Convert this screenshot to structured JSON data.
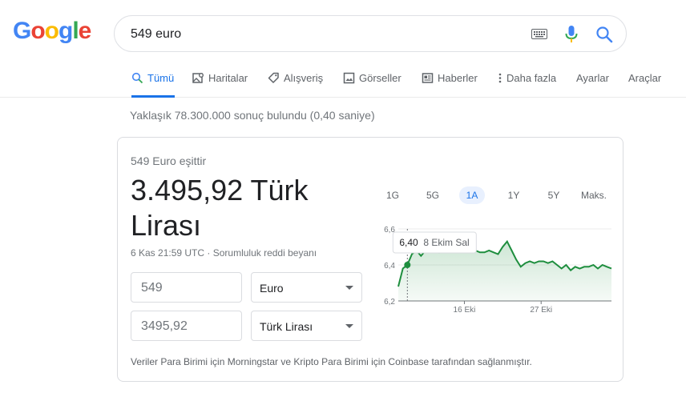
{
  "logo": {
    "letters": [
      "G",
      "o",
      "o",
      "g",
      "l",
      "e"
    ],
    "colors": [
      "#4285F4",
      "#EA4335",
      "#FBBC05",
      "#4285F4",
      "#34A853",
      "#EA4335"
    ]
  },
  "search": {
    "query": "549 euro"
  },
  "tabs": [
    {
      "label": "Tümü",
      "icon": "search-icon"
    },
    {
      "label": "Haritalar",
      "icon": "map-icon"
    },
    {
      "label": "Alışveriş",
      "icon": "tag-icon"
    },
    {
      "label": "Görseller",
      "icon": "image-icon"
    },
    {
      "label": "Haberler",
      "icon": "news-icon"
    },
    {
      "label": "Daha fazla",
      "icon": "more-vert-icon"
    },
    {
      "label": "Ayarlar"
    },
    {
      "label": "Araçlar"
    }
  ],
  "stats": "Yaklaşık 78.300.000 sonuç bulundu (0,40 saniye)",
  "converter": {
    "equals_label": "549 Euro eşittir",
    "result_line1": "3.495,92 Türk",
    "result_line2": "Lirası",
    "timestamp": "6 Kas 21:59 UTC",
    "separator": " · ",
    "disclaimer": "Sorumluluk reddi beyanı",
    "from_value": "549",
    "from_currency": "Euro",
    "to_value": "3495,92",
    "to_currency": "Türk Lirası",
    "source_note": "Veriler Para Birimi için Morningstar ve Kripto Para Birimi için Coinbase tarafından sağlanmıştır."
  },
  "ranges": [
    "1G",
    "5G",
    "1A",
    "1Y",
    "5Y",
    "Maks."
  ],
  "active_range": "1A",
  "chart_data": {
    "type": "area",
    "y_ticks": [
      "6,6",
      "6,4",
      "6,2"
    ],
    "ylim": [
      6.2,
      6.6
    ],
    "x_ticks": [
      "16 Eki",
      "27 Eki"
    ],
    "values": [
      6.28,
      6.38,
      6.4,
      6.46,
      6.48,
      6.45,
      6.48,
      6.5,
      6.49,
      6.47,
      6.5,
      6.49,
      6.47,
      6.48,
      6.47,
      6.48,
      6.47,
      6.48,
      6.47,
      6.47,
      6.48,
      6.47,
      6.46,
      6.5,
      6.53,
      6.48,
      6.43,
      6.39,
      6.41,
      6.42,
      6.41,
      6.42,
      6.42,
      6.41,
      6.42,
      6.4,
      6.38,
      6.4,
      6.37,
      6.39,
      6.38,
      6.39,
      6.39,
      6.4,
      6.38,
      6.4,
      6.39,
      6.38
    ],
    "tooltip": {
      "value": "6,40",
      "date": "8 Ekim Sal"
    },
    "line_color": "#1e8e3e"
  }
}
